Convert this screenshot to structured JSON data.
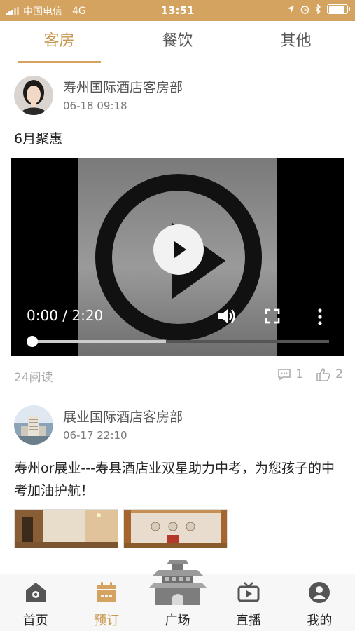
{
  "status": {
    "carrier": "中国电信",
    "network": "4G",
    "time": "13:51",
    "battery_level": 0.9
  },
  "tabs": [
    {
      "label": "客房",
      "active": true
    },
    {
      "label": "餐饮",
      "active": false
    },
    {
      "label": "其他",
      "active": false
    }
  ],
  "posts": [
    {
      "author": "寿州国际酒店客房部",
      "time": "06-18 09:18",
      "title": "6月聚惠",
      "video": {
        "time_label": "0:00 / 2:20",
        "buffered_fraction": 0.45
      },
      "reads": "24阅读",
      "comments": "1",
      "likes": "2"
    },
    {
      "author": "展业国际酒店客房部",
      "time": "06-17 22:10",
      "title": "寿州or展业---寿县酒店业双星助力中考，为您孩子的中考加油护航！"
    }
  ],
  "bottom_nav": [
    {
      "label": "首页",
      "icon": "home-icon",
      "active": false
    },
    {
      "label": "预订",
      "icon": "calendar-icon",
      "active": true
    },
    {
      "label": "广场",
      "icon": "pagoda-icon",
      "active": false
    },
    {
      "label": "直播",
      "icon": "tv-icon",
      "active": false
    },
    {
      "label": "我的",
      "icon": "user-icon",
      "active": false
    }
  ],
  "colors": {
    "accent": "#d3a35f",
    "accent_text": "#c9974d"
  }
}
